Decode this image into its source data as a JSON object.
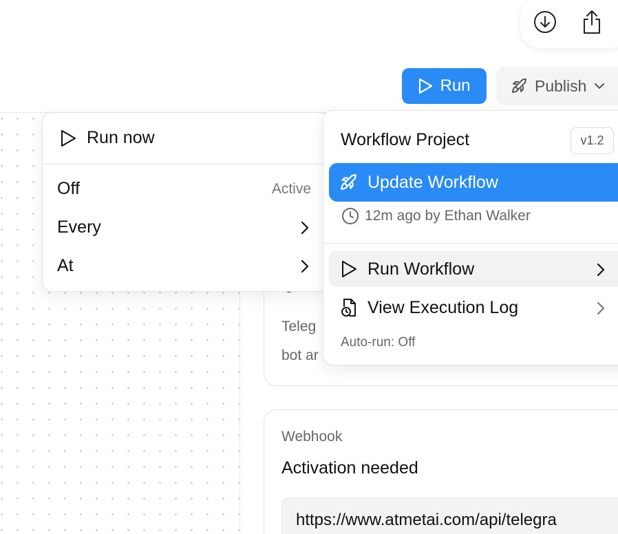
{
  "header": {
    "run_label": "Run",
    "publish_label": "Publish"
  },
  "run_menu": {
    "run_now_label": "Run now",
    "items": [
      {
        "label": "Off",
        "meta": "Active"
      },
      {
        "label": "Every",
        "meta": ""
      },
      {
        "label": "At",
        "meta": ""
      }
    ]
  },
  "publish_menu": {
    "title": "Workflow Project",
    "version": "v1.2",
    "update_label": "Update Workflow",
    "updated_meta": "12m ago by Ethan Walker",
    "run_workflow_label": "Run Workflow",
    "execution_log_label": "View Execution Log",
    "auto_run_status": "Auto-run: Off"
  },
  "cards": {
    "telegram_line1": "Teleg",
    "telegram_line2": "bot ar",
    "webhook_label": "Webhook",
    "webhook_status": "Activation needed",
    "webhook_url": "https://www.atmetai.com/api/telegra"
  },
  "colors": {
    "accent": "#2a8af6",
    "hover_row": "#f2f2f2",
    "muted_text": "#666666"
  },
  "icons": {
    "download": "download-icon",
    "share": "share-icon",
    "play": "play-icon",
    "rocket": "rocket-icon",
    "clock": "clock-icon",
    "file_clock": "file-clock-icon",
    "chevron": "chevron-right-icon"
  }
}
